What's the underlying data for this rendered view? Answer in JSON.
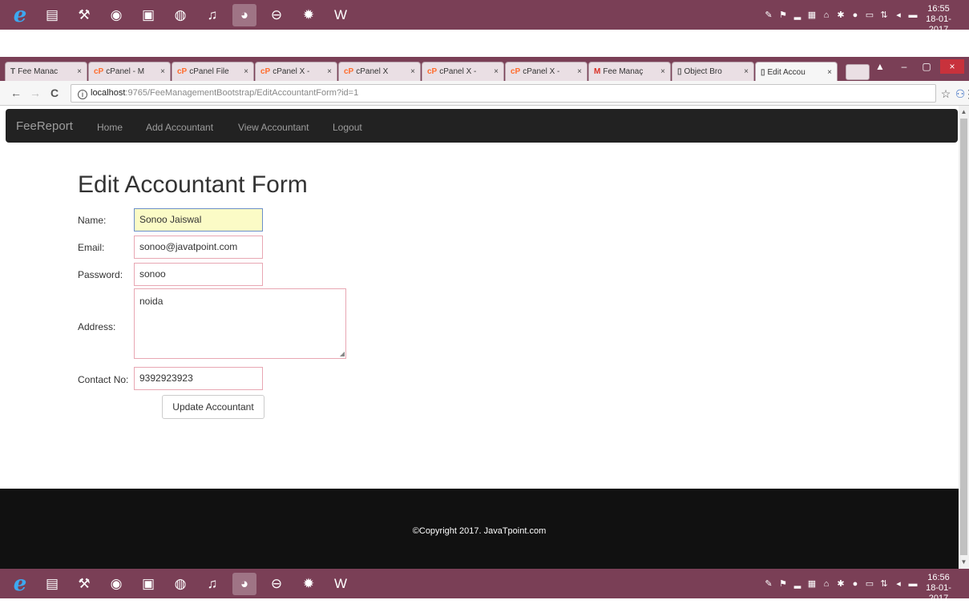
{
  "taskbar": {
    "apps": [
      {
        "name": "internet-explorer-icon",
        "glyph": "e"
      },
      {
        "name": "file-explorer-icon",
        "glyph": "▤"
      },
      {
        "name": "tools-icon",
        "glyph": "⚒"
      },
      {
        "name": "media-player-icon",
        "glyph": "◉"
      },
      {
        "name": "video-icon",
        "glyph": "▣"
      },
      {
        "name": "audio-recorder-icon",
        "glyph": "◍"
      },
      {
        "name": "itunes-icon",
        "glyph": "♫"
      },
      {
        "name": "chrome-icon",
        "glyph": "◕"
      },
      {
        "name": "eclipse-icon",
        "glyph": "⊖"
      },
      {
        "name": "java-ee-icon",
        "glyph": "✹"
      },
      {
        "name": "word-icon",
        "glyph": "W"
      }
    ],
    "tray_glyphs": [
      "✎",
      "⚑",
      "▂",
      "▦",
      "⌂",
      "✱",
      "●",
      "▭",
      "⇅",
      "◂",
      "▬"
    ],
    "top_time": "16:55",
    "top_date": "18-01-2017",
    "bottom_time": "16:56",
    "bottom_date": "18-01-2017"
  },
  "browser": {
    "tabs": [
      {
        "icon": "T",
        "label": "Fee Manac",
        "color": "#555555"
      },
      {
        "icon": "cP",
        "label": "cPanel - M",
        "color": "#ff6c2c"
      },
      {
        "icon": "cP",
        "label": "cPanel File",
        "color": "#ff6c2c"
      },
      {
        "icon": "cP",
        "label": "cPanel X -",
        "color": "#ff6c2c"
      },
      {
        "icon": "cP",
        "label": "cPanel X",
        "color": "#ff6c2c"
      },
      {
        "icon": "cP",
        "label": "cPanel X -",
        "color": "#ff6c2c"
      },
      {
        "icon": "cP",
        "label": "cPanel X -",
        "color": "#ff6c2c"
      },
      {
        "icon": "M",
        "label": "Fee Manaç",
        "color": "#d93025"
      },
      {
        "icon": "▯",
        "label": "Object Bro",
        "color": "#555555"
      },
      {
        "icon": "▯",
        "label": "Edit Accou",
        "color": "#555555"
      }
    ],
    "tab_close": "×",
    "url_host": "localhost",
    "url_path": ":9765/FeeManagementBootstrap/EditAccountantForm?id=1",
    "back": "←",
    "forward": "→",
    "reload": "C",
    "info": "i",
    "star": "☆",
    "profile": "⚇",
    "menu": "⋮",
    "win_user": "▲",
    "win_min": "–",
    "win_max": "▢",
    "win_close": "×"
  },
  "navbar": {
    "brand": "FeeReport",
    "links": [
      "Home",
      "Add Accountant",
      "View Accountant",
      "Logout"
    ]
  },
  "form": {
    "title": "Edit Accountant Form",
    "name_label": "Name:",
    "name_value": "Sonoo Jaiswal",
    "email_label": "Email:",
    "email_value": "sonoo@javatpoint.com",
    "password_label": "Password:",
    "password_value": "sonoo",
    "address_label": "Address:",
    "address_value": "noida",
    "contact_label": "Contact No:",
    "contact_value": "9392923923",
    "submit_label": "Update Accountant"
  },
  "footer": {
    "copyright": "©Copyright 2017. JavaTpoint.com"
  },
  "colors": {
    "taskbar": "#7a3f56",
    "navbar": "#222222",
    "footer": "#111111",
    "focused_input": "#fbfbc6",
    "input_border": "#e8a7b3"
  }
}
